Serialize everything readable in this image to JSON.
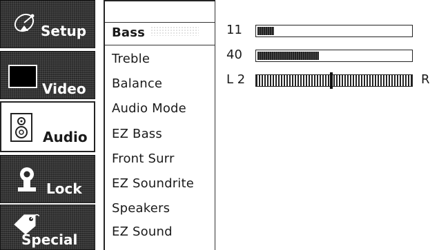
{
  "tabs": [
    {
      "label": "Setup",
      "icon": "satellite-dish-icon",
      "active": false
    },
    {
      "label": "Video",
      "icon": "monitor-icon",
      "active": false
    },
    {
      "label": "Audio",
      "icon": "speaker-icon",
      "active": true
    },
    {
      "label": "Lock",
      "icon": "padlock-icon",
      "active": false
    },
    {
      "label": "Special",
      "icon": "tag-icon",
      "active": false
    }
  ],
  "menu": {
    "items": [
      {
        "label": "Bass",
        "selected": true
      },
      {
        "label": "Treble",
        "selected": false
      },
      {
        "label": "Balance",
        "selected": false
      },
      {
        "label": "Audio Mode",
        "selected": false
      },
      {
        "label": "EZ Bass",
        "selected": false
      },
      {
        "label": "Front Surr",
        "selected": false
      },
      {
        "label": "EZ Soundrite",
        "selected": false
      },
      {
        "label": "Speakers",
        "selected": false
      },
      {
        "label": "EZ Sound",
        "selected": false
      }
    ]
  },
  "values": {
    "bass": {
      "text": "11",
      "level": 0.11
    },
    "treble": {
      "text": "40",
      "level": 0.4
    },
    "balance": {
      "left_text": "L 2",
      "right_label": "R",
      "position": 0.48
    }
  },
  "colors": {
    "tab_bg": "#2a2a2a",
    "tab_text": "#ffffff",
    "text": "#1a1a1a",
    "bar": "#333333"
  }
}
